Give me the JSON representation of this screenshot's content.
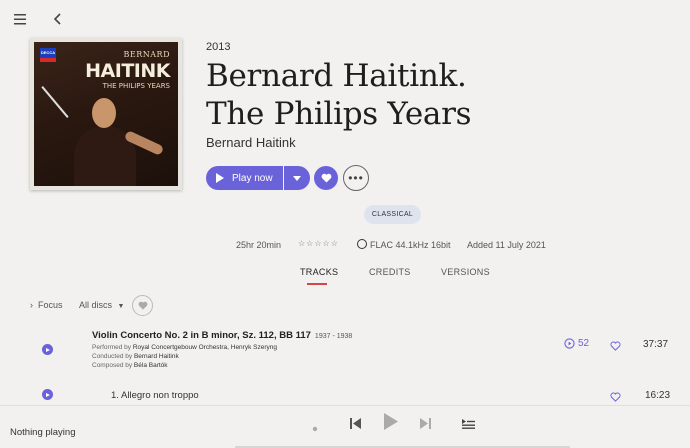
{
  "nav": {
    "menu_icon": "hamburger-menu-icon",
    "back_icon": "back-arrow-icon"
  },
  "cover": {
    "label": "DECCA",
    "artist_first": "BERNARD",
    "artist_last": "HAITINK",
    "subtitle": "THE PHILIPS YEARS"
  },
  "album": {
    "year": "2013",
    "title_line1": "Bernard Haitink.",
    "title_line2": "The Philips Years",
    "artist": "Bernard Haitink"
  },
  "actions": {
    "play_label": "Play now",
    "accent_color": "#6a62d8"
  },
  "genre": "CLASSICAL",
  "meta": {
    "duration": "25hr 20min",
    "rating": "☆☆☆☆☆",
    "quality": "FLAC 44.1kHz 16bit",
    "added": "Added 11 July 2021"
  },
  "tabs": [
    {
      "label": "TRACKS",
      "active": true
    },
    {
      "label": "CREDITS",
      "active": false
    },
    {
      "label": "VERSIONS",
      "active": false
    }
  ],
  "filters": {
    "focus_label": "Focus",
    "discs_label": "All discs"
  },
  "work": {
    "title": "Violin Concerto No. 2 in B minor, Sz. 112, BB 117",
    "years": "1937 - 1938",
    "performed_prefix": "Performed by",
    "performed": "Royal Concertgebouw Orchestra, Henryk Szeryng",
    "conducted_prefix": "Conducted by",
    "conducted": "Bernard Haitink",
    "composed_prefix": "Composed by",
    "composed": "Béla Bartók",
    "track_count": "52",
    "duration": "37:37"
  },
  "track": {
    "title": "1. Allegro non troppo",
    "duration": "16:23"
  },
  "player": {
    "status": "Nothing playing"
  }
}
